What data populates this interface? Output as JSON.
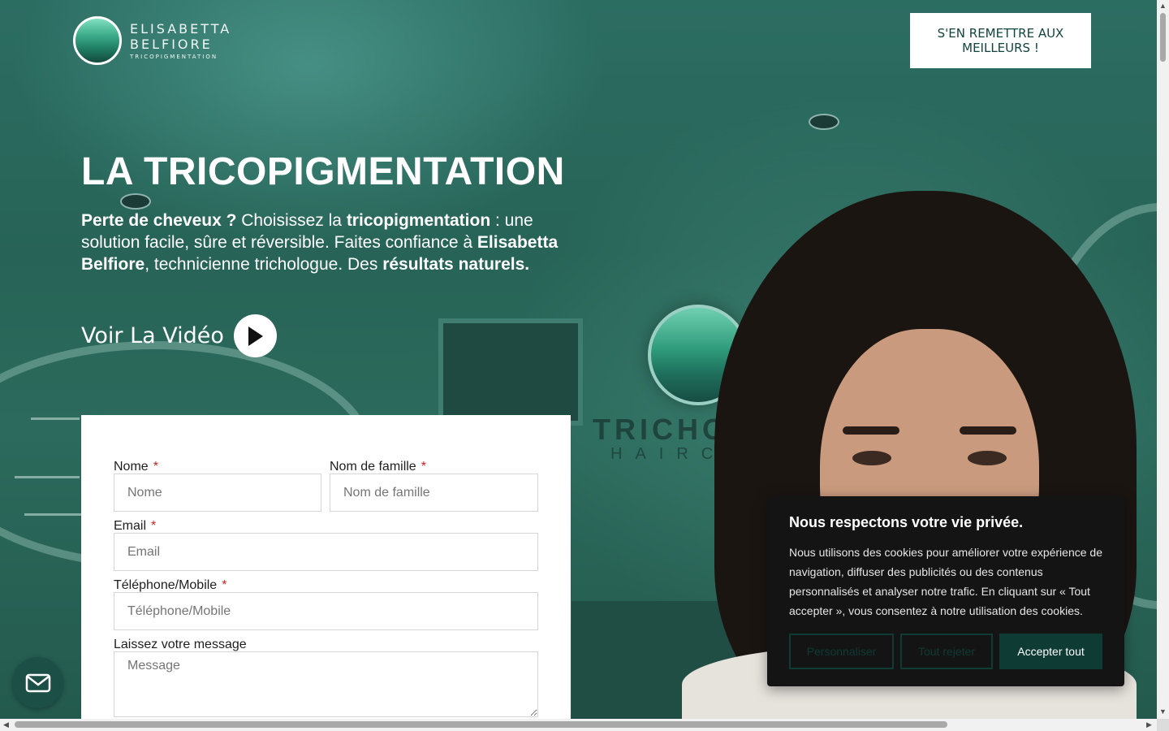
{
  "brand": {
    "line1": "ELISABETTA",
    "line2": "BELFIORE",
    "line3": "TRICOPIGMENTATION"
  },
  "header": {
    "cta_label": "S'EN REMETTRE AUX MEILLEURS !"
  },
  "hero": {
    "title": "LA TRICOPIGMENTATION",
    "intro": {
      "p1_bold": "Perte de cheveux ?",
      "p2": " Choisissez la ",
      "p3_bold": "tricopigmentation",
      "p4": " : une solution facile, sûre et réversible. Faites confiance à ",
      "p5_bold": "Elisabetta Belfiore",
      "p6": ", technicienne trichologue. Des ",
      "p7_bold": "résultats naturels."
    },
    "video_label": "Voir La Vidéo",
    "wall_sign": "TRICHOLOG",
    "wall_sub": "HAIRCAR"
  },
  "form": {
    "first_name": {
      "label": "Nome",
      "placeholder": "Nome"
    },
    "last_name": {
      "label": "Nom de famille",
      "placeholder": "Nom de famille"
    },
    "email": {
      "label": "Email",
      "placeholder": "Email"
    },
    "phone": {
      "label": "Téléphone/Mobile",
      "placeholder": "Téléphone/Mobile"
    },
    "message": {
      "label": "Laissez votre message",
      "placeholder": "Message"
    },
    "required_mark": "*"
  },
  "cookie_banner": {
    "title": "Nous respectons votre vie privée.",
    "text": "Nous utilisons des cookies pour améliorer votre expérience de navigation, diffuser des publicités ou des contenus personnalisés et analyser notre trafic. En cliquant sur « Tout accepter », vous consentez à notre utilisation des cookies.",
    "customize_label": "Personnaliser",
    "reject_label": "Tout rejeter",
    "accept_label": "Accepter tout"
  },
  "colors": {
    "brand_dark": "#0e3b34",
    "hero_green": "#276457",
    "required": "#d0201d"
  },
  "icons": [
    "play-icon",
    "envelope-icon",
    "scroll-arrow-up-icon",
    "scroll-arrow-down-icon",
    "scroll-arrow-left-icon",
    "scroll-arrow-right-icon"
  ]
}
